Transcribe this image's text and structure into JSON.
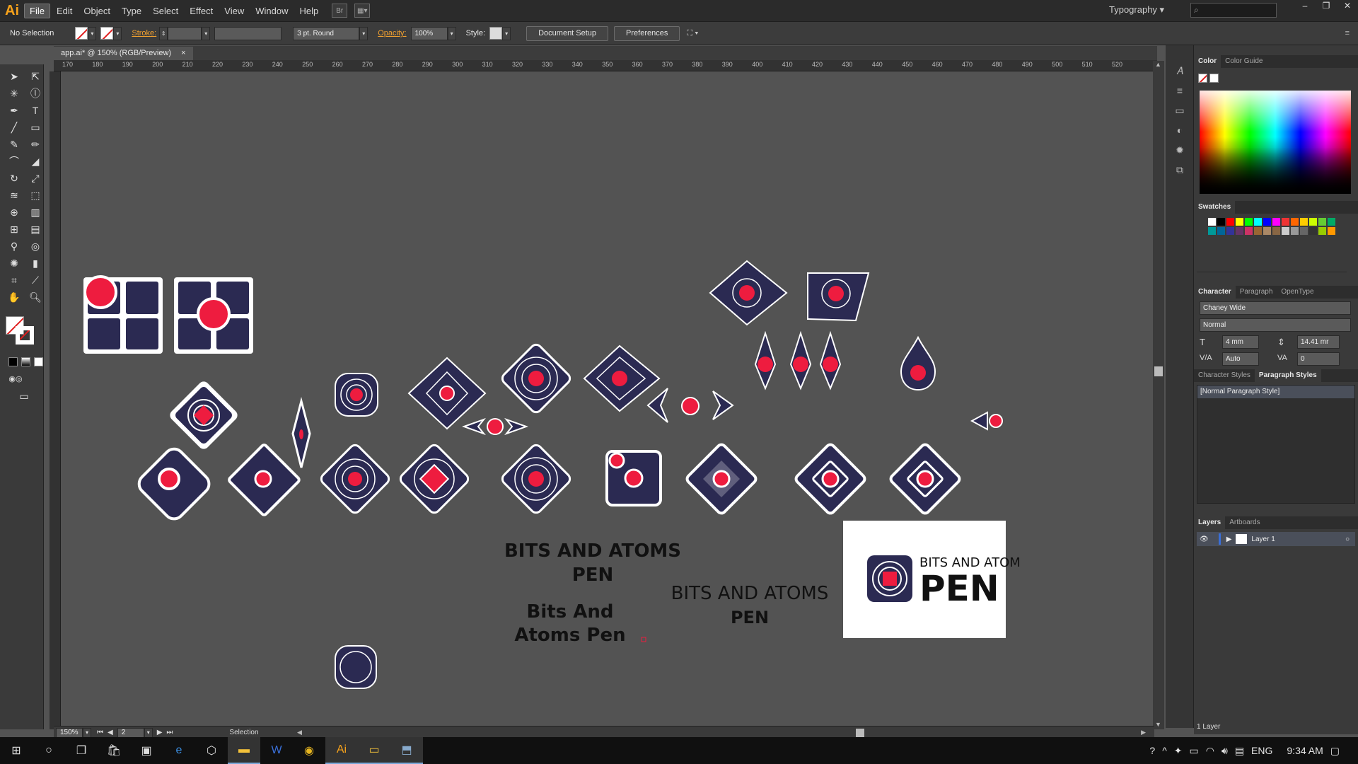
{
  "app": {
    "logo": "Ai",
    "workspace": "Typography",
    "search_placeholder": ""
  },
  "menu": [
    "File",
    "Edit",
    "Object",
    "Type",
    "Select",
    "Effect",
    "View",
    "Window",
    "Help"
  ],
  "control_bar": {
    "selection": "No Selection",
    "stroke_label": "Stroke:",
    "brush": "3 pt. Round",
    "opacity_label": "Opacity:",
    "opacity_value": "100%",
    "style_label": "Style:",
    "document_setup": "Document Setup",
    "preferences": "Preferences"
  },
  "document_tab": {
    "title": "app.ai* @ 150% (RGB/Preview)",
    "close": "×"
  },
  "ruler_ticks": [
    "170",
    "180",
    "190",
    "200",
    "210",
    "220",
    "230",
    "240",
    "250",
    "260",
    "270",
    "280",
    "290",
    "300",
    "310",
    "320",
    "330",
    "340",
    "350",
    "360",
    "370",
    "380",
    "390",
    "400",
    "410",
    "420",
    "430",
    "440",
    "450",
    "460",
    "470",
    "480",
    "490",
    "500",
    "510",
    "520"
  ],
  "vertical_ruler": [
    "2",
    "0",
    "1",
    "2",
    "1",
    "4",
    "1",
    "6",
    "1",
    "8",
    "2",
    "0",
    "2",
    "2",
    "2",
    "4",
    "2",
    "6",
    "2",
    "8",
    "3",
    "0"
  ],
  "canvas_text": {
    "title1_line1": "BITS AND ATOMS",
    "title1_line2": "PEN",
    "title2_line1": "Bits And",
    "title2_line2": "Atoms Pen",
    "title3_line1": "BITS AND ATOMS",
    "title3_line2": "PEN",
    "logo_line1": "BITS AND ATOM",
    "logo_line2": "PEN"
  },
  "status": {
    "zoom": "150%",
    "artboard": "2",
    "tool": "Selection"
  },
  "panels": {
    "color_tabs": [
      "Color",
      "Color Guide"
    ],
    "swatches_tab": "Swatches",
    "character_tabs": [
      "Character",
      "Paragraph",
      "OpenType"
    ],
    "font_family": "Chaney Wide",
    "font_style": "Normal",
    "font_size": "4 mm",
    "leading": "14.41 mr",
    "kerning": "Auto",
    "tracking": "0",
    "style_tabs": [
      "Character Styles",
      "Paragraph Styles"
    ],
    "paragraph_style_item": "[Normal Paragraph Style]",
    "layers_tabs": [
      "Layers",
      "Artboards"
    ],
    "layer_name": "Layer 1",
    "layer_count": "1 Layer"
  },
  "taskbar": {
    "time": "9:34 AM",
    "lang": "ENG"
  },
  "colors": {
    "navy": "#2b2a52",
    "red": "#ee1c3f",
    "canvas": "#535353"
  }
}
